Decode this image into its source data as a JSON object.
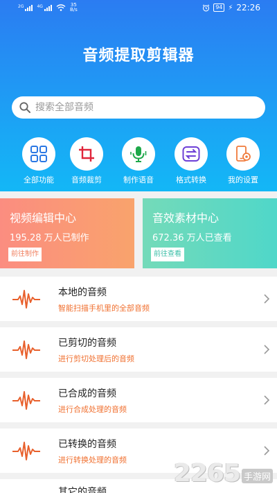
{
  "status_bar": {
    "signal1_tag": "2G",
    "signal2_tag": "4G",
    "speed_value": "35",
    "speed_unit": "B/s",
    "battery": "94",
    "time": "22:26"
  },
  "app": {
    "title": "音频提取剪辑器"
  },
  "search": {
    "placeholder": "搜索全部音频"
  },
  "functions": [
    {
      "label": "全部功能",
      "icon": "grid-icon"
    },
    {
      "label": "音频裁剪",
      "icon": "crop-icon"
    },
    {
      "label": "制作语音",
      "icon": "microphone-icon"
    },
    {
      "label": "格式转换",
      "icon": "convert-icon"
    },
    {
      "label": "我的设置",
      "icon": "phone-settings-icon"
    }
  ],
  "cards": [
    {
      "title": "视频编辑中心",
      "count": "195.28 万人已制作",
      "button": "前往制作"
    },
    {
      "title": "音效素材中心",
      "count": "672.36 万人已查看",
      "button": "前往查看"
    }
  ],
  "list": [
    {
      "name": "本地的音频",
      "desc": "智能扫描手机里的全部音频"
    },
    {
      "name": "已剪切的音频",
      "desc": "进行剪切处理后的音频"
    },
    {
      "name": "已合成的音频",
      "desc": "进行合成处理的音频"
    },
    {
      "name": "已转换的音频",
      "desc": "进行转换处理的音频"
    },
    {
      "name": "其它的音频",
      "desc": ""
    }
  ],
  "watermark": {
    "number": "2265",
    "text": "手游网"
  },
  "colors": {
    "header_blue": "#2b7cf2",
    "accent_orange": "#f07030",
    "card_left": "#fb8d80",
    "card_right": "#4fd7c9",
    "icon_blue": "#2a78e4",
    "icon_red": "#e0253a",
    "icon_green": "#1ea84a",
    "icon_purple": "#6d3fd6"
  }
}
